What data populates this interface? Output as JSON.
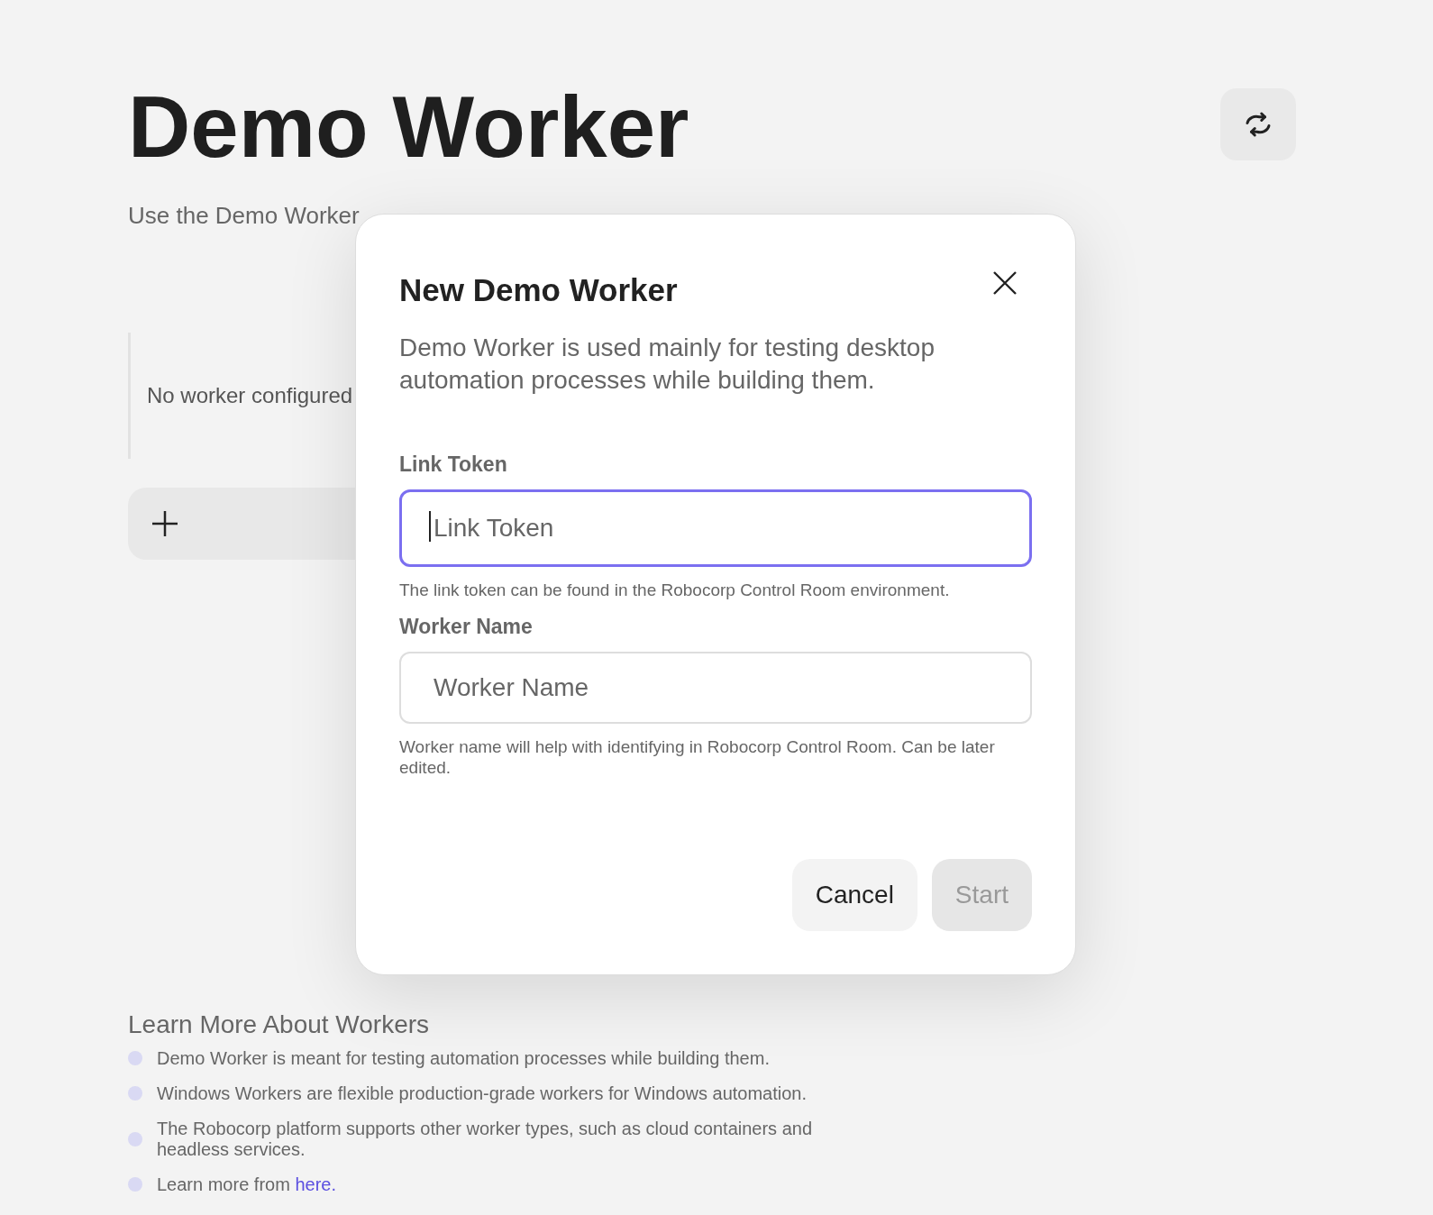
{
  "page": {
    "title": "Demo Worker",
    "subtitle": "Use the Demo Worker"
  },
  "workers": {
    "empty_text": "No worker configured"
  },
  "learn_more": {
    "heading": "Learn More About Workers",
    "items": [
      {
        "text": "Demo Worker is meant for testing automation processes while building them."
      },
      {
        "text": "Windows Workers are flexible production-grade workers for Windows automation."
      },
      {
        "text": "The Robocorp platform supports other worker types, such as cloud containers and headless services."
      },
      {
        "text": "Learn more from ",
        "link": "here."
      }
    ]
  },
  "dialog": {
    "title": "New Demo Worker",
    "description": "Demo Worker is used mainly for testing desktop automation processes while building them.",
    "fields": [
      {
        "label": "Link Token",
        "placeholder": "Link Token",
        "focused": true,
        "help": "The link token can be found in the Robocorp Control Room environment."
      },
      {
        "label": "Worker Name",
        "placeholder": "Worker Name",
        "focused": false,
        "help": "Worker name will help with identifying in Robocorp Control Room. Can be later edited."
      }
    ],
    "buttons": [
      {
        "label": "Cancel",
        "disabled": false
      },
      {
        "label": "Start",
        "disabled": true
      }
    ]
  }
}
